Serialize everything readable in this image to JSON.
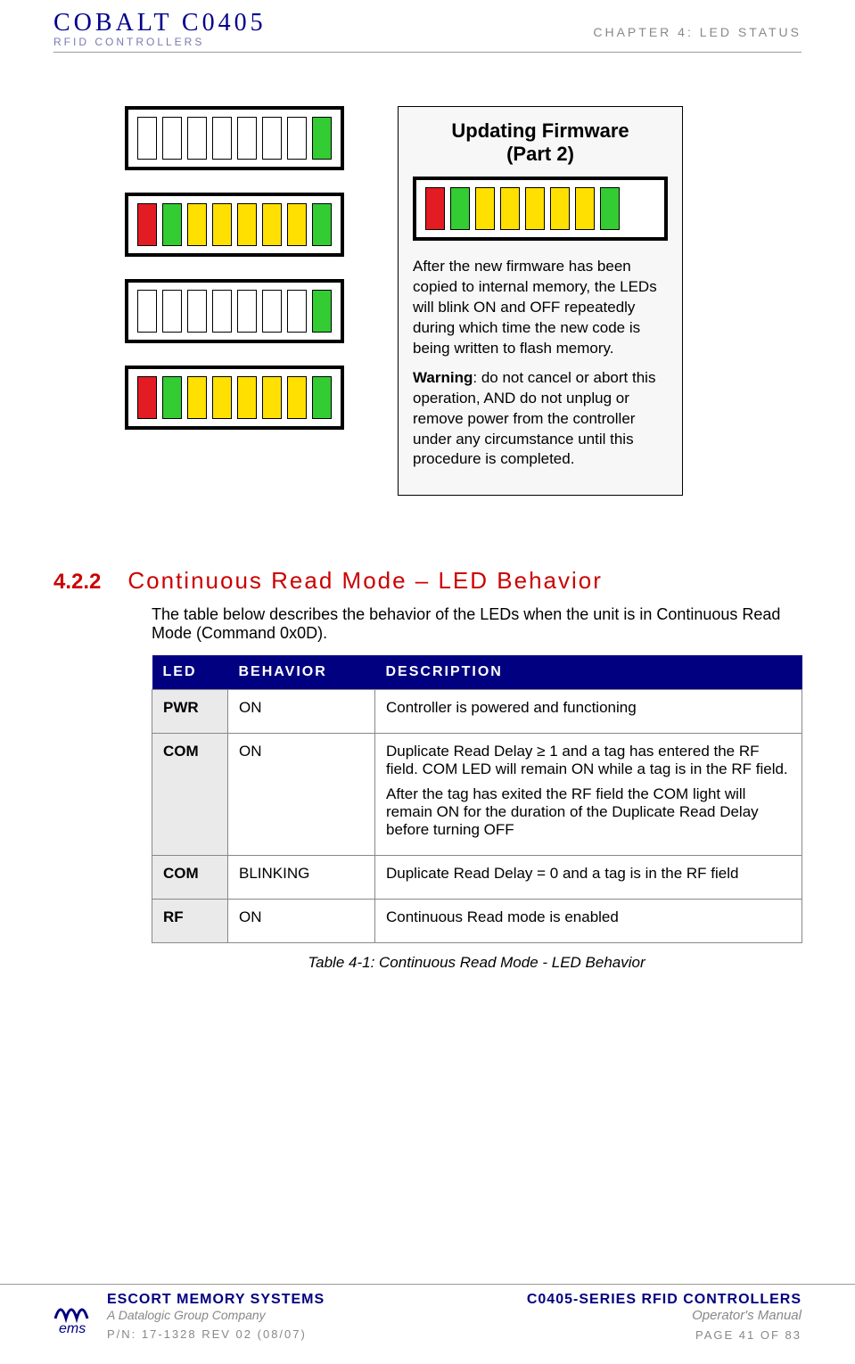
{
  "header": {
    "brand_main": "COBALT C0405",
    "brand_sub": "RFID CONTROLLERS",
    "chapter": "CHAPTER 4: LED STATUS"
  },
  "led_stacks": [
    [
      "white",
      "white",
      "white",
      "white",
      "white",
      "white",
      "white",
      "green"
    ],
    [
      "red",
      "green",
      "yellow",
      "yellow",
      "yellow",
      "yellow",
      "yellow",
      "green"
    ],
    [
      "white",
      "white",
      "white",
      "white",
      "white",
      "white",
      "white",
      "green"
    ],
    [
      "red",
      "green",
      "yellow",
      "yellow",
      "yellow",
      "yellow",
      "yellow",
      "green"
    ]
  ],
  "callout": {
    "title_line1": "Updating Firmware",
    "title_line2": "(Part 2)",
    "leds": [
      "red",
      "green",
      "yellow",
      "yellow",
      "yellow",
      "yellow",
      "yellow",
      "green"
    ],
    "para1": "After the new firmware has been copied to internal memory, the LEDs will blink ON and OFF repeatedly during which time the new code is being written to flash memory.",
    "warn_label": "Warning",
    "para2": ": do not cancel or abort this operation, AND do not unplug or remove power from the controller under any circumstance until this procedure is completed."
  },
  "section": {
    "number": "4.2.2",
    "title": "Continuous Read Mode – LED Behavior",
    "intro": "The table below describes the behavior of the LEDs when the unit is in Continuous Read Mode (Command 0x0D).",
    "table": {
      "headers": {
        "led": "LED",
        "behavior": "BEHAVIOR",
        "description": "DESCRIPTION"
      },
      "rows": [
        {
          "led": "PWR",
          "behavior": "ON",
          "desc": [
            "Controller is powered and functioning"
          ]
        },
        {
          "led": "COM",
          "behavior": "ON",
          "desc": [
            "Duplicate Read Delay ≥ 1 and a tag has entered the RF field. COM LED will remain ON while a tag is in the RF field.",
            "After the tag has exited the RF field the COM light will remain ON for the duration of the Duplicate Read Delay before turning OFF"
          ]
        },
        {
          "led": "COM",
          "behavior": "BLINKING",
          "desc": [
            "Duplicate Read Delay = 0 and a tag is in the RF field"
          ]
        },
        {
          "led": "RF",
          "behavior": "ON",
          "desc": [
            "Continuous Read mode is enabled"
          ]
        }
      ],
      "caption": "Table 4-1: Continuous Read Mode - LED Behavior"
    }
  },
  "footer": {
    "brand_main": "ESCORT MEMORY SYSTEMS",
    "brand_sub": "A Datalogic Group Company",
    "logo_text": "ems",
    "pn": "P/N: 17-1328 REV 02 (08/07)",
    "series": "C0405-SERIES RFID CONTROLLERS",
    "manual": "Operator's Manual",
    "page": "PAGE 41 OF 83"
  }
}
